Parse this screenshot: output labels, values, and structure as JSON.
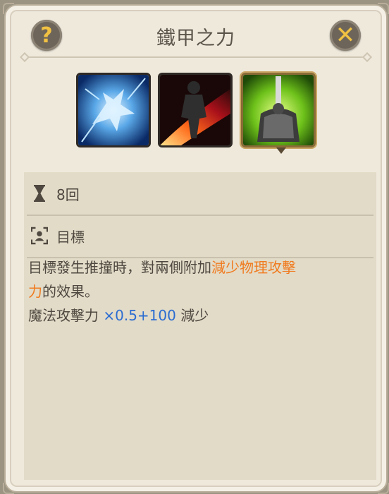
{
  "header": {
    "title": "鐵甲之力",
    "help_glyph": "?",
    "close_glyph": "✕"
  },
  "skill_icons": [
    {
      "name": "ice-wolf-skill-icon",
      "selected": false
    },
    {
      "name": "fire-slash-skill-icon",
      "selected": false
    },
    {
      "name": "iron-armor-skill-icon",
      "selected": true
    }
  ],
  "details": {
    "duration_label": "8回",
    "target_label": "目標"
  },
  "description": {
    "line1_prefix": "目標發生推撞時，對兩側附加",
    "line1_highlight": "減少物理攻擊",
    "line2_highlight": "力",
    "line2_suffix": "的效果。",
    "line3_prefix": "魔法攻擊力 ",
    "line3_value": "×0.5+100",
    "line3_suffix": " 減少"
  },
  "colors": {
    "highlight": "#f07b1f",
    "value": "#2b6cd1",
    "accent_gold": "#f1c142"
  }
}
